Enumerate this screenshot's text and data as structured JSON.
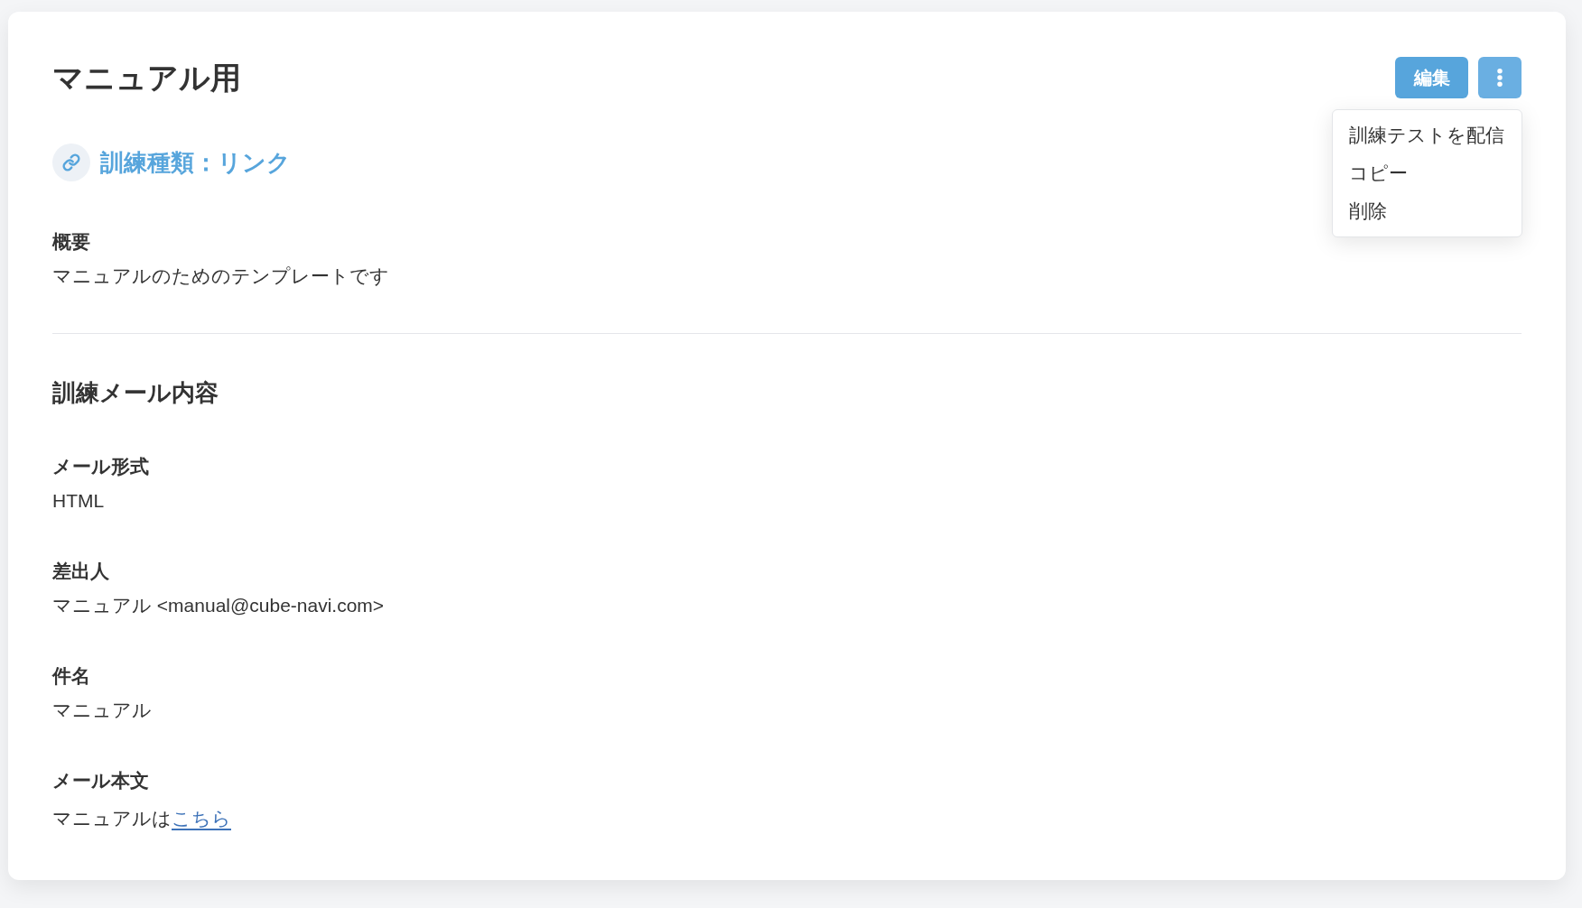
{
  "page": {
    "title": "マニュアル用"
  },
  "actions": {
    "edit_button": {
      "label": "編集"
    },
    "more_button": {
      "expanded": true
    },
    "menu_items": [
      "訓練テストを配信",
      "コピー",
      "削除"
    ]
  },
  "training_type": {
    "label": "訓練種類：リンク"
  },
  "overview": {
    "label": "概要",
    "value": "マニュアルのためのテンプレートです"
  },
  "mail_content": {
    "title": "訓練メール内容",
    "fields": [
      {
        "label": "メール形式",
        "value": "HTML"
      },
      {
        "label": "差出人",
        "value": "マニュアル <manual@cube-navi.com>"
      },
      {
        "label": "件名",
        "value": "マニュアル"
      },
      {
        "label": "メール本文",
        "value_parts": [
          {
            "kind": "text",
            "text": "マニュアルは"
          },
          {
            "kind": "link",
            "text": "こちら"
          }
        ]
      }
    ]
  }
}
